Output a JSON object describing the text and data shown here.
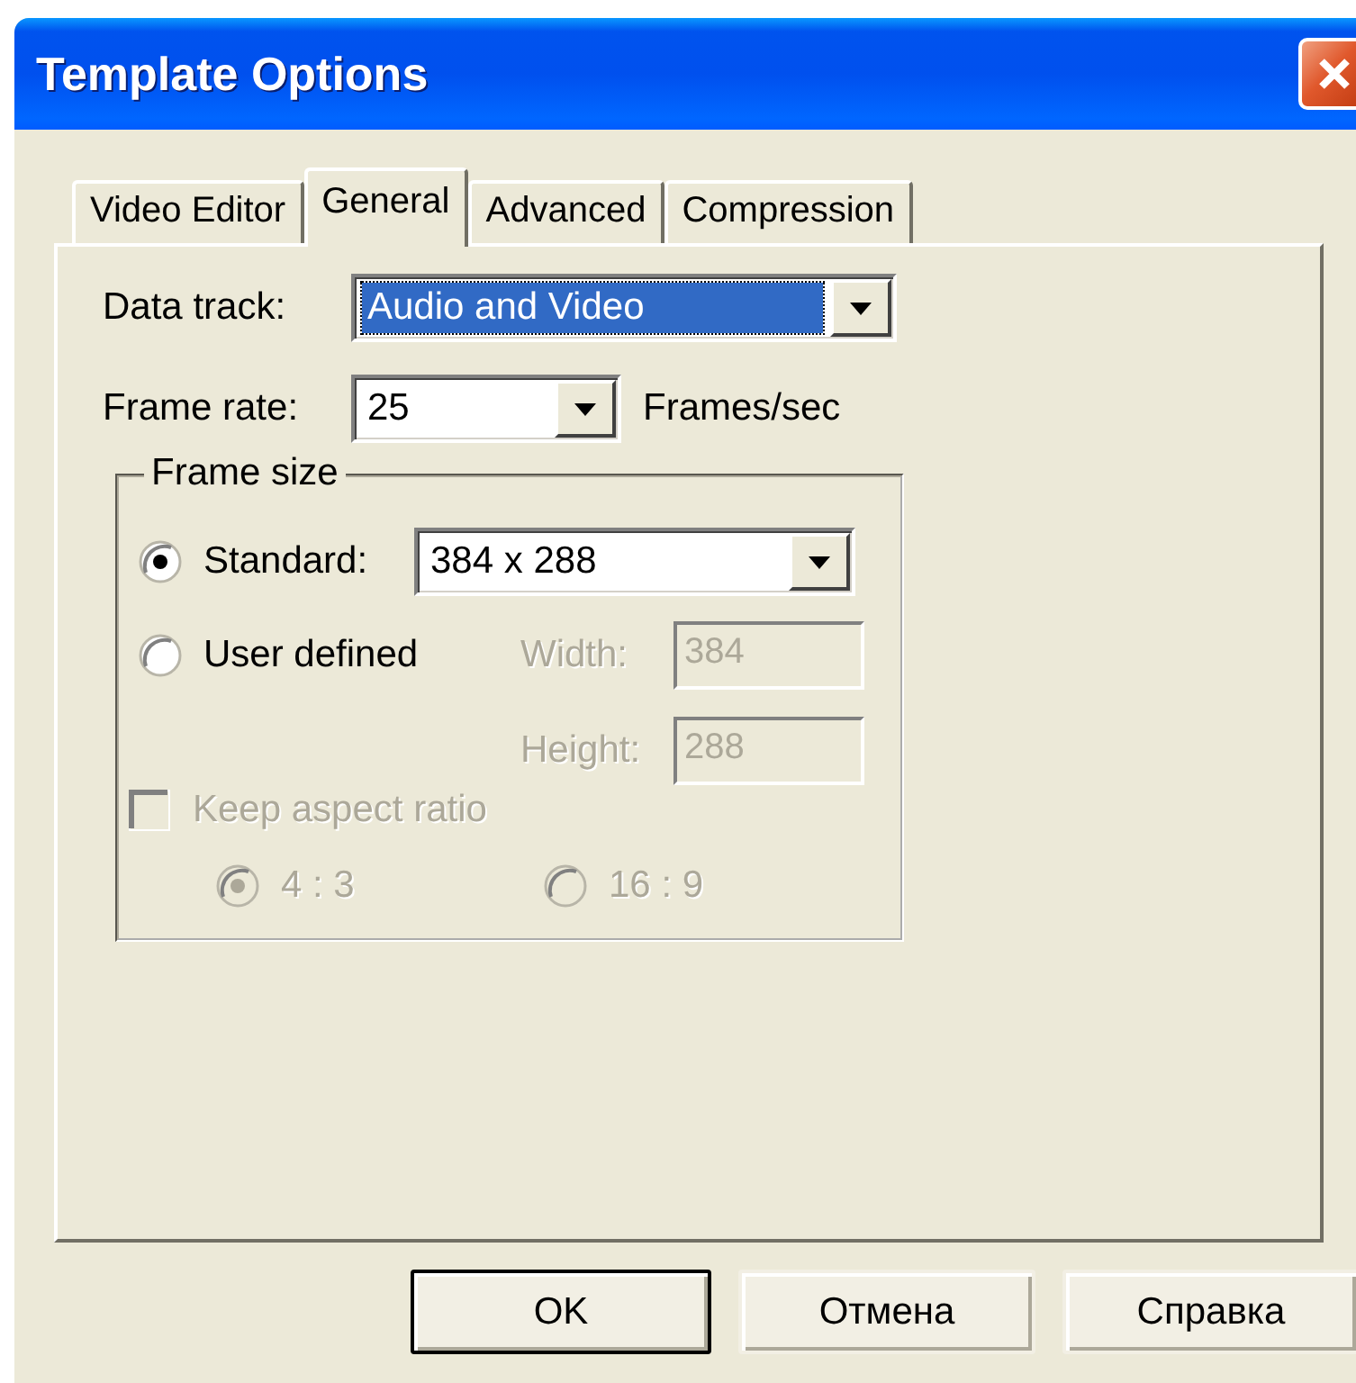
{
  "window": {
    "title": "Template Options"
  },
  "tabs": [
    {
      "label": "Video Editor",
      "selected": false
    },
    {
      "label": "General",
      "selected": true
    },
    {
      "label": "Advanced",
      "selected": false
    },
    {
      "label": "Compression",
      "selected": false
    }
  ],
  "data_track": {
    "label": "Data track:",
    "value": "Audio and Video",
    "focused": true
  },
  "frame_rate": {
    "label": "Frame rate:",
    "value": "25",
    "focused": false,
    "unit": "Frames/sec"
  },
  "frame_size": {
    "title": "Frame size",
    "standard": {
      "label": "Standard:",
      "selected": true,
      "value": "384 x 288",
      "focused": false
    },
    "user_defined": {
      "label": "User defined",
      "selected": false
    },
    "width": {
      "label": "Width:",
      "value": "384",
      "disabled": true
    },
    "height": {
      "label": "Height:",
      "value": "288",
      "disabled": true
    },
    "keep_aspect": {
      "label": "Keep aspect ratio",
      "checked": false,
      "disabled": true
    },
    "ratios": [
      {
        "label": "4 : 3",
        "selected": true,
        "disabled": true
      },
      {
        "label": "16 : 9",
        "selected": false,
        "disabled": true
      }
    ]
  },
  "buttons": [
    {
      "label": "OK",
      "default": true
    },
    {
      "label": "Отмена",
      "default": false
    },
    {
      "label": "Справка",
      "default": false
    }
  ]
}
